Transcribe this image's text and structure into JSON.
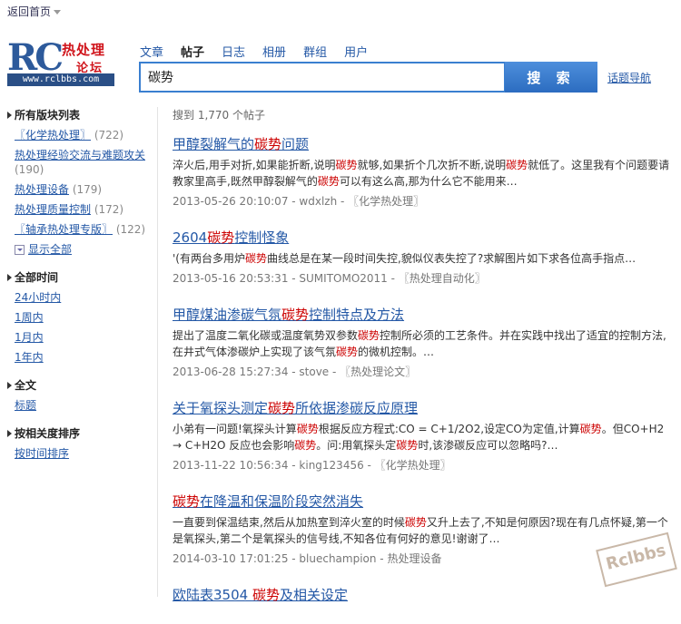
{
  "topbar": {
    "back_home": "返回首页"
  },
  "logo": {
    "brand": "RC",
    "cn_line1": "热处理",
    "cn_line2": "论坛",
    "url": "www.rclbbs.com"
  },
  "tabs": [
    {
      "label": "文章",
      "active": false
    },
    {
      "label": "帖子",
      "active": true
    },
    {
      "label": "日志",
      "active": false
    },
    {
      "label": "相册",
      "active": false
    },
    {
      "label": "群组",
      "active": false
    },
    {
      "label": "用户",
      "active": false
    }
  ],
  "search": {
    "value": "碳势",
    "button": "搜 索",
    "topic_nav": "话题导航"
  },
  "sidebar": {
    "boards": {
      "title": "所有版块列表",
      "items": [
        {
          "label": "〖化学热处理〗",
          "count": "(722)"
        },
        {
          "label": "热处理经验交流与难题攻关",
          "count": "(190)"
        },
        {
          "label": "热处理设备",
          "count": "(179)"
        },
        {
          "label": "热处理质量控制",
          "count": "(172)"
        },
        {
          "label": "〖轴承热处理专版〗",
          "count": "(122)"
        }
      ],
      "show_all": "显示全部"
    },
    "time": {
      "title": "全部时间",
      "items": [
        "24小时内",
        "1周内",
        "1月内",
        "1年内"
      ]
    },
    "fulltext": {
      "title": "全文",
      "items": [
        "标题"
      ]
    },
    "sort": {
      "title": "按相关度排序",
      "items": [
        "按时间排序"
      ]
    }
  },
  "results": {
    "count_text": "搜到 1,770 个帖子",
    "items": [
      {
        "title": [
          {
            "t": "甲醇裂解气的"
          },
          {
            "t": "碳势",
            "h": true
          },
          {
            "t": "问题"
          }
        ],
        "snippet": [
          {
            "t": "淬火后,用手对折,如果能折断,说明"
          },
          {
            "t": "碳势",
            "h": true
          },
          {
            "t": "就够,如果折个几次折不断,说明"
          },
          {
            "t": "碳势",
            "h": true
          },
          {
            "t": "就低了。这里我有个问题要请教家里高手,既然甲醇裂解气的"
          },
          {
            "t": "碳势",
            "h": true
          },
          {
            "t": "可以有这么高,那为什么它不能用来…"
          }
        ],
        "meta": "2013-05-26 20:10:07 - wdxlzh - 〖化学热处理〗"
      },
      {
        "title": [
          {
            "t": "2604"
          },
          {
            "t": "碳势",
            "h": true
          },
          {
            "t": "控制怪象"
          }
        ],
        "snippet": [
          {
            "t": "'(有两台多用炉"
          },
          {
            "t": "碳势",
            "h": true
          },
          {
            "t": "曲线总是在某一段时间失控,貌似仪表失控了?求解图片如下求各位高手指点…"
          }
        ],
        "meta": "2013-05-16 20:53:31 - SUMITOMO2011 - 〖热处理自动化〗"
      },
      {
        "title": [
          {
            "t": "甲醇煤油渗碳气氛"
          },
          {
            "t": "碳势",
            "h": true
          },
          {
            "t": "控制特点及方法"
          }
        ],
        "snippet": [
          {
            "t": "提出了温度二氧化碳或温度氧势双参数"
          },
          {
            "t": "碳势",
            "h": true
          },
          {
            "t": "控制所必须的工艺条件。并在实践中找出了适宜的控制方法,在井式气体渗碳炉上实现了该气氛"
          },
          {
            "t": "碳势",
            "h": true
          },
          {
            "t": "的微机控制。…"
          }
        ],
        "meta": "2013-06-28 15:27:34 - stove - 〖热处理论文〗"
      },
      {
        "title": [
          {
            "t": "关于氧探头测定"
          },
          {
            "t": "碳势",
            "h": true
          },
          {
            "t": "所依据渗碳反应原理"
          }
        ],
        "snippet": [
          {
            "t": "小弟有一问题!氧探头计算"
          },
          {
            "t": "碳势",
            "h": true
          },
          {
            "t": "根据反应方程式:CO = C+1/2O2,设定CO为定值,计算"
          },
          {
            "t": "碳势",
            "h": true
          },
          {
            "t": "。但CO+H2 → C+H2O 反应也会影响"
          },
          {
            "t": "碳势",
            "h": true
          },
          {
            "t": "。问:用氧探头定"
          },
          {
            "t": "碳势",
            "h": true
          },
          {
            "t": "时,该渗碳反应可以忽略吗?…"
          }
        ],
        "meta": "2013-11-22 10:56:34 - king123456 - 〖化学热处理〗"
      },
      {
        "title": [
          {
            "t": "碳势",
            "h": true
          },
          {
            "t": "在降温和保温阶段突然消失"
          }
        ],
        "snippet": [
          {
            "t": "一直要到保温结束,然后从加热室到淬火室的时候"
          },
          {
            "t": "碳势",
            "h": true
          },
          {
            "t": "又升上去了,不知是何原因?现在有几点怀疑,第一个是氧探头,第二个是氧探头的信号线,不知各位有何好的意见!谢谢了…"
          }
        ],
        "meta": "2014-03-10 17:01:25 - bluechampion - 热处理设备"
      },
      {
        "title": [
          {
            "t": "欧陆表3504 "
          },
          {
            "t": "碳势",
            "h": true
          },
          {
            "t": "及相关设定"
          }
        ],
        "snippet": [],
        "meta": ""
      }
    ]
  },
  "watermark": "Rclbbs"
}
